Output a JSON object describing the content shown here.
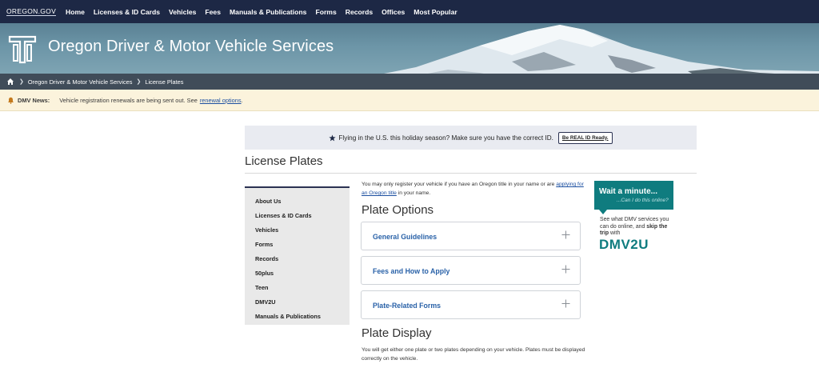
{
  "topnav": {
    "logo_text": "OREGON.GOV",
    "items": [
      "Home",
      "Licenses & ID Cards",
      "Vehicles",
      "Fees",
      "Manuals & Publications",
      "Forms",
      "Records",
      "Offices",
      "Most Popular"
    ]
  },
  "banner": {
    "title": "Oregon Driver & Motor Vehicle Services"
  },
  "breadcrumb": {
    "items": [
      "Oregon Driver & Motor Vehicle Services",
      "License Plates"
    ]
  },
  "news": {
    "label": "DMV News:",
    "text": "Vehicle registration renewals are being sent out. See",
    "link": "renewal options",
    "end": "."
  },
  "alert": {
    "text": "Flying in the U.S. this holiday season? Make sure you have the correct ID.",
    "button": "Be REAL ID Ready."
  },
  "page": {
    "title": "License Plates"
  },
  "sidebar": {
    "items": [
      "About Us",
      "Licenses & ID Cards",
      "Vehicles",
      "Forms",
      "Records",
      "50plus",
      "Teen",
      "DMV2U",
      "Manuals & Publications"
    ]
  },
  "main": {
    "intro_before": "You may only register your vehicle if you have an Oregon title in your name or are",
    "intro_link": "applying for an Oregon title",
    "intro_after": "in your name.",
    "options_heading": "Plate Options",
    "accordions": [
      "General Guidelines",
      "Fees and How to Apply",
      "Plate-Related Forms"
    ],
    "display_heading": "Plate Display",
    "display_text": "You will get either one plate or two plates depending on your vehicle.  Plates must be displayed correctly on the vehicle."
  },
  "promo": {
    "heading": "Wait a minute...",
    "sub": "...Can I do this online?",
    "body_1": "See what DMV services you can do online, and",
    "body_bold": "skip the trip",
    "body_2": "with",
    "brand": "DMV2U"
  },
  "colors": {
    "nav": "#1d2845",
    "accent": "#0f7c7f",
    "link": "#2a62a8",
    "news_bg": "#fbf3dc"
  }
}
